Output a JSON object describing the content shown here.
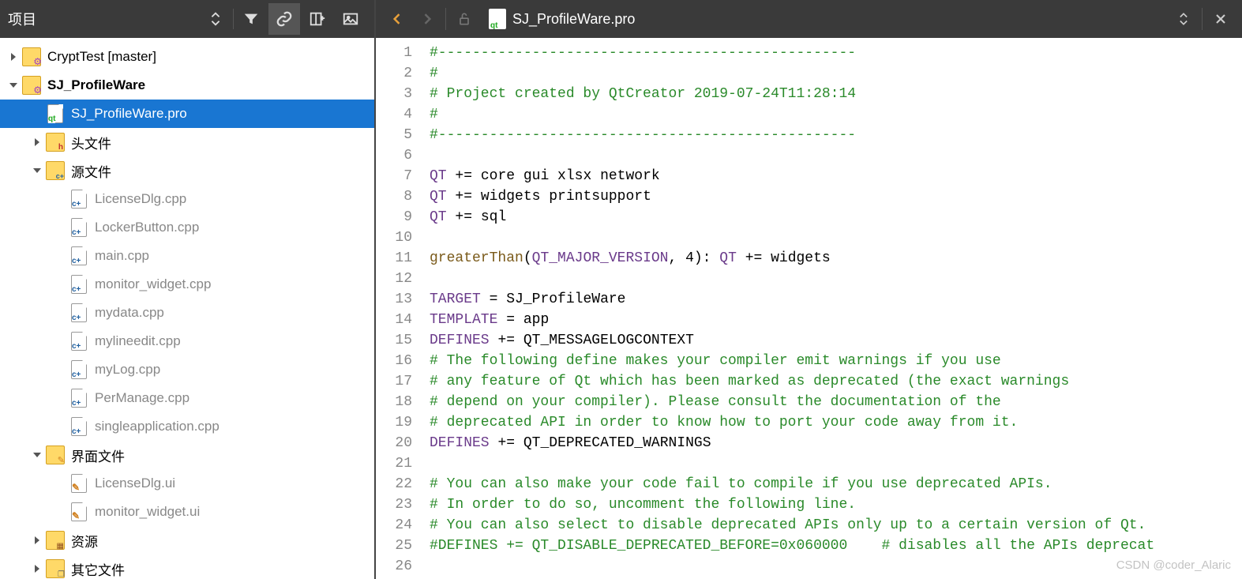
{
  "sidebar": {
    "title": "项目",
    "tools": {
      "updown": "⇕",
      "filter": "filter-icon",
      "link": "link-icon",
      "split_add": "split-add-icon",
      "image": "image-icon"
    }
  },
  "tree": [
    {
      "id": "crypttest",
      "depth": 0,
      "arrow": "right",
      "icon": "folder-gear",
      "label": "CryptTest [master]",
      "bold": false,
      "dim": false
    },
    {
      "id": "profileware",
      "depth": 0,
      "arrow": "down",
      "icon": "folder-gear",
      "label": "SJ_ProfileWare",
      "bold": true,
      "dim": false
    },
    {
      "id": "pro-file",
      "depth": 1,
      "arrow": "none",
      "icon": "file-qt",
      "label": "SJ_ProfileWare.pro",
      "bold": false,
      "dim": false,
      "selected": true
    },
    {
      "id": "headers",
      "depth": 1,
      "arrow": "right",
      "icon": "folder-h",
      "label": "头文件",
      "bold": false,
      "dim": false
    },
    {
      "id": "sources",
      "depth": 1,
      "arrow": "down",
      "icon": "folder-cpp",
      "label": "源文件",
      "bold": false,
      "dim": false
    },
    {
      "id": "licensedlg-cpp",
      "depth": 2,
      "arrow": "none",
      "icon": "file-cpp",
      "label": "LicenseDlg.cpp",
      "bold": false,
      "dim": true
    },
    {
      "id": "lockerbutton-cpp",
      "depth": 2,
      "arrow": "none",
      "icon": "file-cpp",
      "label": "LockerButton.cpp",
      "bold": false,
      "dim": true
    },
    {
      "id": "main-cpp",
      "depth": 2,
      "arrow": "none",
      "icon": "file-cpp",
      "label": "main.cpp",
      "bold": false,
      "dim": true
    },
    {
      "id": "monitor-widget-cpp",
      "depth": 2,
      "arrow": "none",
      "icon": "file-cpp",
      "label": "monitor_widget.cpp",
      "bold": false,
      "dim": true
    },
    {
      "id": "mydata-cpp",
      "depth": 2,
      "arrow": "none",
      "icon": "file-cpp",
      "label": "mydata.cpp",
      "bold": false,
      "dim": true
    },
    {
      "id": "mylineedit-cpp",
      "depth": 2,
      "arrow": "none",
      "icon": "file-cpp",
      "label": "mylineedit.cpp",
      "bold": false,
      "dim": true
    },
    {
      "id": "mylog-cpp",
      "depth": 2,
      "arrow": "none",
      "icon": "file-cpp",
      "label": "myLog.cpp",
      "bold": false,
      "dim": true
    },
    {
      "id": "permanage-cpp",
      "depth": 2,
      "arrow": "none",
      "icon": "file-cpp",
      "label": "PerManage.cpp",
      "bold": false,
      "dim": true
    },
    {
      "id": "singleapp-cpp",
      "depth": 2,
      "arrow": "none",
      "icon": "file-cpp",
      "label": "singleapplication.cpp",
      "bold": false,
      "dim": true
    },
    {
      "id": "forms",
      "depth": 1,
      "arrow": "down",
      "icon": "folder-edit",
      "label": "界面文件",
      "bold": false,
      "dim": false
    },
    {
      "id": "licensedlg-ui",
      "depth": 2,
      "arrow": "none",
      "icon": "file-ui",
      "label": "LicenseDlg.ui",
      "bold": false,
      "dim": true
    },
    {
      "id": "monitor-widget-ui",
      "depth": 2,
      "arrow": "none",
      "icon": "file-ui",
      "label": "monitor_widget.ui",
      "bold": false,
      "dim": true
    },
    {
      "id": "resources",
      "depth": 1,
      "arrow": "right",
      "icon": "folder-db",
      "label": "资源",
      "bold": false,
      "dim": false
    },
    {
      "id": "other",
      "depth": 1,
      "arrow": "right",
      "icon": "folder-copy",
      "label": "其它文件",
      "bold": false,
      "dim": false
    }
  ],
  "editor": {
    "tab_filename": "SJ_ProfileWare.pro",
    "watermark": "CSDN @coder_Alaric"
  },
  "code_lines": [
    {
      "n": 1,
      "t": "comment",
      "text": "#-------------------------------------------------"
    },
    {
      "n": 2,
      "t": "comment",
      "text": "#"
    },
    {
      "n": 3,
      "t": "comment",
      "text": "# Project created by QtCreator 2019-07-24T11:28:14"
    },
    {
      "n": 4,
      "t": "comment",
      "text": "#"
    },
    {
      "n": 5,
      "t": "comment",
      "text": "#-------------------------------------------------"
    },
    {
      "n": 6,
      "t": "blank",
      "text": ""
    },
    {
      "n": 7,
      "t": "assign",
      "var": "QT",
      "op": "+=",
      "val": "core gui xlsx network"
    },
    {
      "n": 8,
      "t": "assign",
      "var": "QT",
      "op": "+=",
      "val": "widgets printsupport"
    },
    {
      "n": 9,
      "t": "assign",
      "var": "QT",
      "op": "+=",
      "val": "sql"
    },
    {
      "n": 10,
      "t": "blank",
      "text": ""
    },
    {
      "n": 11,
      "t": "func",
      "fn": "greaterThan",
      "args_var": "QT_MAJOR_VERSION",
      "args_rest": ", 4):",
      "tail_var": " QT",
      "tail_op": " +=",
      "tail_val": " widgets"
    },
    {
      "n": 12,
      "t": "blank",
      "text": ""
    },
    {
      "n": 13,
      "t": "assign",
      "var": "TARGET",
      "op": "=",
      "val": "SJ_ProfileWare"
    },
    {
      "n": 14,
      "t": "assign",
      "var": "TEMPLATE",
      "op": "=",
      "val": "app"
    },
    {
      "n": 15,
      "t": "assign",
      "var": "DEFINES",
      "op": "+=",
      "val": "QT_MESSAGELOGCONTEXT"
    },
    {
      "n": 16,
      "t": "comment",
      "text": "# The following define makes your compiler emit warnings if you use"
    },
    {
      "n": 17,
      "t": "comment",
      "text": "# any feature of Qt which has been marked as deprecated (the exact warnings"
    },
    {
      "n": 18,
      "t": "comment",
      "text": "# depend on your compiler). Please consult the documentation of the"
    },
    {
      "n": 19,
      "t": "comment",
      "text": "# deprecated API in order to know how to port your code away from it."
    },
    {
      "n": 20,
      "t": "assign",
      "var": "DEFINES",
      "op": "+=",
      "val": "QT_DEPRECATED_WARNINGS"
    },
    {
      "n": 21,
      "t": "blank",
      "text": ""
    },
    {
      "n": 22,
      "t": "comment",
      "text": "# You can also make your code fail to compile if you use deprecated APIs."
    },
    {
      "n": 23,
      "t": "comment",
      "text": "# In order to do so, uncomment the following line."
    },
    {
      "n": 24,
      "t": "comment",
      "text": "# You can also select to disable deprecated APIs only up to a certain version of Qt."
    },
    {
      "n": 25,
      "t": "comment",
      "text": "#DEFINES += QT_DISABLE_DEPRECATED_BEFORE=0x060000    # disables all the APIs deprecat"
    },
    {
      "n": 26,
      "t": "blank",
      "text": ""
    }
  ]
}
